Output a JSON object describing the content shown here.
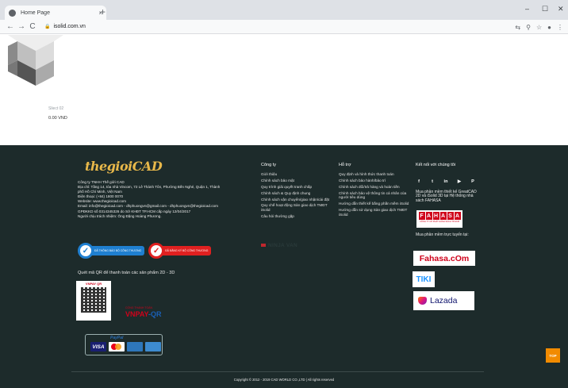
{
  "browser": {
    "tab_title": "Home Page",
    "tab_close": "×",
    "new_tab": "+",
    "url": "isolid.com.vn",
    "window_controls": {
      "minimize": "–",
      "maximize": "☐",
      "close": "✕"
    },
    "nav": {
      "back": "←",
      "forward": "→",
      "reload": "C"
    },
    "toolbar_icons": [
      "translate-icon",
      "zoom-icon",
      "bookmark-star-icon",
      "profile-icon",
      "menu-icon"
    ]
  },
  "product": {
    "name": "Sliect 02",
    "price": "0.00 VND"
  },
  "footer": {
    "logo": "thegioiCAD",
    "company_lines": [
      "Công ty TNHH Thế giới CAD",
      "Địa chỉ: Tầng 14, tòa nhà Vincom, 72 Lê Thánh Tôn, Phường Bến Nghé, Quận 1, Thành phố Hồ Chí Minh, Việt Nam",
      "Điện thoại: (+84) 1800 0070",
      "Website: www.thegioicad.com",
      "Email: info@thegioicad.com - dhphuongvn@gmail.com - dhphuongvn@thegioicad.com",
      "GPĐKKD số 0314345326 do Sở KHĐT TP.HCM cấp ngày 12/04/2017",
      "Người chịu trách nhiệm: Ông Đặng Hoàng Phương."
    ],
    "badges": [
      {
        "label": "ĐÃ THÔNG BÁO BỘ CÔNG THƯƠNG"
      },
      {
        "label": "ĐÃ ĐĂNG KÝ BỘ CÔNG THƯƠNG"
      }
    ],
    "qr_label": "Quét mã QR để thanh toán các sản phẩm 2D - 3D",
    "qr_brand": "VNPAY QR",
    "vnpay_small": "CỔNG THANH TOÁN",
    "vnpay_brand": {
      "a": "VNPAY",
      "b": "-QR"
    },
    "paypal": "PayPal",
    "cards": [
      "VISA",
      "",
      "AMEX",
      "BANK"
    ],
    "col1": {
      "title": "Công ty",
      "items": [
        "Giới thiệu",
        "Chính sách bảo mật",
        "Quy trình giải quyết tranh chấp",
        "Chính sách & Quy định chung",
        "Chính sách vận chuyển/giao nhận/cài đặt",
        "Quy chế hoạt động Sàn giao dịch TMĐT iSolid",
        "Câu hỏi thường gặp"
      ]
    },
    "ninjavan": "NINJA VAN",
    "col2": {
      "title": "Hỗ trợ",
      "items": [
        "Quy định và hình thức thanh toán",
        "Chính sách bảo hành/bảo trì",
        "Chính sách đổi/trả hàng và hoàn tiền",
        "Chính sách bảo vệ thông tin cá nhân của người tiêu dùng",
        "Hướng dẫn thiết kế bằng phần mềm iSolid",
        "Hướng dẫn sử dụng Sàn giao dịch TMĐT iSolid"
      ]
    },
    "social": {
      "title": "Kết nối với chúng tôi",
      "icons": [
        {
          "name": "facebook-icon",
          "glyph": "f"
        },
        {
          "name": "twitter-icon",
          "glyph": "t"
        },
        {
          "name": "linkedin-icon",
          "glyph": "in"
        },
        {
          "name": "youtube-icon",
          "glyph": "▶"
        },
        {
          "name": "pinterest-icon",
          "glyph": "P"
        }
      ]
    },
    "fahasa_label": "Mua phần mềm thiết kế GreatCAD 2D và iSolid 3D tại Hệ thống nhà sách FAHASA",
    "fahasa_letters": [
      "F",
      "A",
      "H",
      "A",
      "S",
      "A"
    ],
    "fahasa_sub": "CÔNG TY CP PHÁT HÀNH SÁCH TP.HCM",
    "online_label": "Mua phần mềm trực tuyến tại:",
    "fahasa_com": "Fahasa.cOm",
    "tiki": "TIKI",
    "lazada": "Lazada",
    "copyright": "Copyright © 2012 - 2019 CAD WORLD CO.,LTD | All rights reserved",
    "top_button": "TOP"
  },
  "colors": {
    "footer_bg": "#1d2b2b",
    "logo": "#e8b84a",
    "top_button": "#f28b00"
  }
}
